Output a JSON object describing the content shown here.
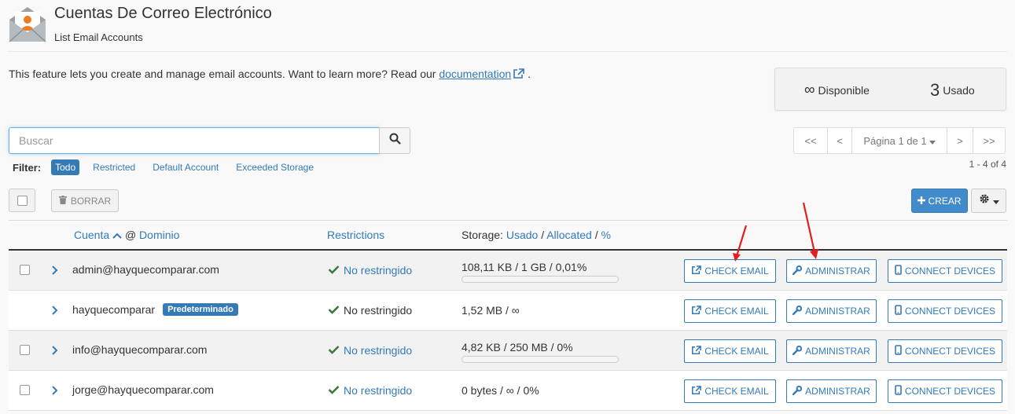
{
  "header": {
    "title": "Cuentas De Correo Electrónico",
    "subtitle": "List Email Accounts"
  },
  "intro": {
    "text": "This feature lets you create and manage email accounts. Want to learn more? Read our",
    "link_text": "documentation",
    "suffix": "."
  },
  "stats": {
    "available_value": "∞",
    "available_label": "Disponible",
    "used_value": "3",
    "used_label": "Usado"
  },
  "search": {
    "placeholder": "Buscar"
  },
  "filter": {
    "label": "Filter:",
    "items": [
      "Todo",
      "Restricted",
      "Default Account",
      "Exceeded Storage"
    ],
    "active": "Todo"
  },
  "pagination": {
    "first": "<<",
    "prev": "<",
    "page_label": "Página 1 de 1",
    "next": ">",
    "last": ">>",
    "range": "1 - 4 of 4"
  },
  "toolbar": {
    "delete_label": "BORRAR",
    "create_label": "CREAR"
  },
  "table": {
    "headers": {
      "account": "Cuenta",
      "at": "@",
      "domain": "Dominio",
      "restrictions": "Restrictions",
      "storage_prefix": "Storage:",
      "storage_used": "Usado",
      "storage_sep1": "/",
      "storage_allocated": "Allocated",
      "storage_sep2": "/",
      "storage_pct": "%"
    },
    "rows": [
      {
        "account": "admin@hayquecomparar.com",
        "badge": "",
        "restriction": "No restringido",
        "storage": "108,11 KB / 1 GB / 0,01%",
        "usage_fraction": 0.0001
      },
      {
        "account": "hayquecomparar",
        "badge": "Predeterminado",
        "restriction": "No restringido",
        "storage": "1,52 MB / ∞",
        "usage_fraction": null
      },
      {
        "account": "info@hayquecomparar.com",
        "badge": "",
        "restriction": "No restringido",
        "storage": "4,82 KB / 250 MB / 0%",
        "usage_fraction": 0
      },
      {
        "account": "jorge@hayquecomparar.com",
        "badge": "",
        "restriction": "No restringido",
        "storage": "0 bytes / ∞ / 0%",
        "usage_fraction": null
      }
    ],
    "actions": {
      "check": "CHECK EMAIL",
      "admin": "ADMINISTRAR",
      "connect": "CONNECT DEVICES"
    }
  },
  "colors": {
    "accent": "#337ab7",
    "primary_button": "#428bca",
    "success": "#3c763d",
    "annotation_arrow": "#e02020"
  }
}
